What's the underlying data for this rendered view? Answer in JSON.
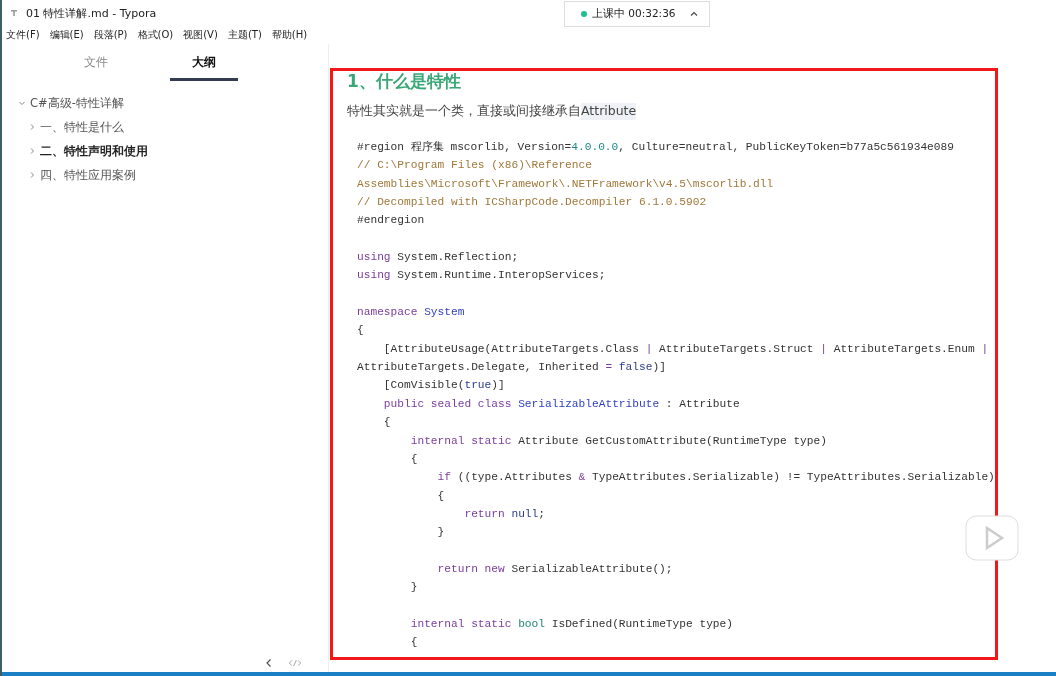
{
  "window": {
    "title": "01 特性详解.md - Typora"
  },
  "menu": [
    "文件(F)",
    "编辑(E)",
    "段落(P)",
    "格式(O)",
    "视图(V)",
    "主题(T)",
    "帮助(H)"
  ],
  "sidebar": {
    "tabs": [
      {
        "label": "文件",
        "selected": false
      },
      {
        "label": "大纲",
        "selected": true
      }
    ],
    "outline": [
      {
        "label": "C#高级-特性详解",
        "expanded": true,
        "selected": false,
        "children": [
          {
            "label": "一、特性是什么",
            "expanded": false,
            "selected": false
          },
          {
            "label": "二、特性声明和使用",
            "expanded": false,
            "selected": true
          },
          {
            "label": "四、特性应用案例",
            "expanded": false,
            "selected": false
          }
        ]
      }
    ]
  },
  "class_timer": {
    "status": "上课中 00:32:36",
    "live": true
  },
  "document": {
    "heading": "1、什么是特性",
    "paragraph": "特性其实就是一个类，直接或间接继承自",
    "inline_code": "Attribute",
    "code_lines": [
      {
        "kind": "code",
        "segments": [
          {
            "kind": "plain",
            "text": "#region 程序集 mscorlib, Version="
          },
          {
            "kind": "number",
            "text": "4.0.0.0"
          },
          {
            "kind": "plain",
            "text": ", Culture=neutral, PublicKeyToken=b77a5c561934e089"
          }
        ]
      },
      {
        "kind": "code",
        "segments": [
          {
            "kind": "comment",
            "text": "// C:\\Program Files (x86)\\Reference"
          }
        ]
      },
      {
        "kind": "code",
        "segments": [
          {
            "kind": "comment",
            "text": "Assemblies\\Microsoft\\Framework\\.NETFramework\\v4.5\\mscorlib.dll"
          }
        ]
      },
      {
        "kind": "code",
        "segments": [
          {
            "kind": "comment",
            "text": "// Decompiled with ICSharpCode.Decompiler 6.1.0.5902"
          }
        ]
      },
      {
        "kind": "code",
        "segments": [
          {
            "kind": "plain",
            "text": "#endregion"
          }
        ]
      },
      {
        "kind": "blank"
      },
      {
        "kind": "code",
        "segments": [
          {
            "kind": "keyword",
            "text": "using"
          },
          {
            "kind": "plain",
            "text": " System.Reflection;"
          }
        ]
      },
      {
        "kind": "code",
        "segments": [
          {
            "kind": "keyword",
            "text": "using"
          },
          {
            "kind": "plain",
            "text": " System.Runtime.InteropServices;"
          }
        ]
      },
      {
        "kind": "blank"
      },
      {
        "kind": "code",
        "segments": [
          {
            "kind": "keyword",
            "text": "namespace"
          },
          {
            "kind": "type",
            "text": " System"
          }
        ]
      },
      {
        "kind": "code",
        "segments": [
          {
            "kind": "plain",
            "text": "{"
          }
        ]
      },
      {
        "kind": "code",
        "segments": [
          {
            "kind": "plain",
            "text": "    [AttributeUsage(AttributeTargets.Class "
          },
          {
            "kind": "operator",
            "text": "|"
          },
          {
            "kind": "plain",
            "text": " AttributeTargets.Struct "
          },
          {
            "kind": "operator",
            "text": "|"
          },
          {
            "kind": "plain",
            "text": " AttributeTargets.Enum "
          },
          {
            "kind": "operator",
            "text": "|"
          }
        ]
      },
      {
        "kind": "code",
        "segments": [
          {
            "kind": "plain",
            "text": "AttributeTargets.Delegate, Inherited "
          },
          {
            "kind": "operator",
            "text": "="
          },
          {
            "kind": "literal",
            "text": " false"
          },
          {
            "kind": "plain",
            "text": ")]"
          }
        ]
      },
      {
        "kind": "code",
        "segments": [
          {
            "kind": "plain",
            "text": "    [ComVisible("
          },
          {
            "kind": "literal",
            "text": "true"
          },
          {
            "kind": "plain",
            "text": ")]"
          }
        ]
      },
      {
        "kind": "code",
        "segments": [
          {
            "kind": "keyword",
            "text": "    public sealed class"
          },
          {
            "kind": "type",
            "text": " SerializableAttribute"
          },
          {
            "kind": "plain",
            "text": " : Attribute"
          }
        ]
      },
      {
        "kind": "code",
        "segments": [
          {
            "kind": "plain",
            "text": "    {"
          }
        ]
      },
      {
        "kind": "code",
        "segments": [
          {
            "kind": "keyword",
            "text": "        internal static"
          },
          {
            "kind": "plain",
            "text": " Attribute GetCustomAttribute(RuntimeType type)"
          }
        ]
      },
      {
        "kind": "code",
        "segments": [
          {
            "kind": "plain",
            "text": "        {"
          }
        ]
      },
      {
        "kind": "code",
        "segments": [
          {
            "kind": "keyword",
            "text": "            if"
          },
          {
            "kind": "plain",
            "text": " ((type.Attributes "
          },
          {
            "kind": "operator",
            "text": "&"
          },
          {
            "kind": "plain",
            "text": " TypeAttributes.Serializable) != TypeAttributes.Serializable)"
          }
        ]
      },
      {
        "kind": "code",
        "segments": [
          {
            "kind": "plain",
            "text": "            {"
          }
        ]
      },
      {
        "kind": "code",
        "segments": [
          {
            "kind": "keyword",
            "text": "                return"
          },
          {
            "kind": "literal",
            "text": " null"
          },
          {
            "kind": "plain",
            "text": ";"
          }
        ]
      },
      {
        "kind": "code",
        "segments": [
          {
            "kind": "plain",
            "text": "            }"
          }
        ]
      },
      {
        "kind": "blank"
      },
      {
        "kind": "code",
        "segments": [
          {
            "kind": "keyword",
            "text": "            return new"
          },
          {
            "kind": "plain",
            "text": " SerializableAttribute();"
          }
        ]
      },
      {
        "kind": "code",
        "segments": [
          {
            "kind": "plain",
            "text": "        }"
          }
        ]
      },
      {
        "kind": "blank"
      },
      {
        "kind": "code",
        "segments": [
          {
            "kind": "keyword",
            "text": "        internal static"
          },
          {
            "kind": "builtin",
            "text": " bool"
          },
          {
            "kind": "plain",
            "text": " IsDefined(RuntimeType type)"
          }
        ]
      },
      {
        "kind": "code",
        "segments": [
          {
            "kind": "plain",
            "text": "        {"
          }
        ]
      }
    ]
  }
}
